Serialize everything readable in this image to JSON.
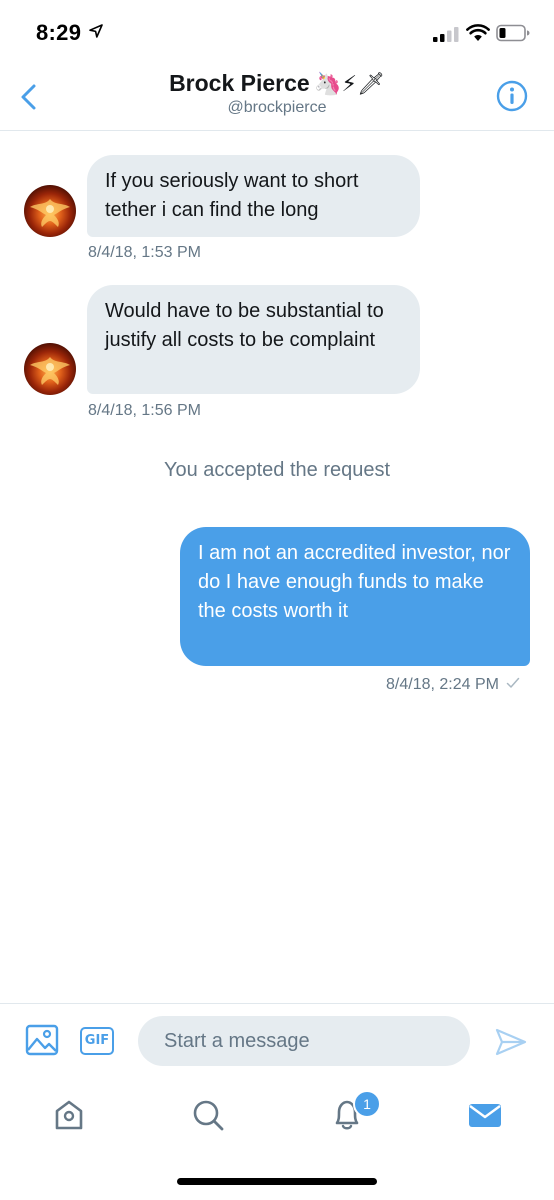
{
  "status_bar": {
    "time": "8:29",
    "icons": [
      "location-arrow-icon",
      "signal-bars-icon",
      "wifi-icon",
      "battery-icon"
    ]
  },
  "header": {
    "back_icon": "chevron-left-icon",
    "name": "Brock Pierce",
    "name_emoji": "🦄⚡🗡",
    "handle": "@brockpierce",
    "info_icon": "info-circle-icon"
  },
  "messages": [
    {
      "direction": "incoming",
      "text": "If you seriously want to short tether i can find the long",
      "timestamp": "8/4/18, 1:53 PM"
    },
    {
      "direction": "incoming",
      "text": "Would have to be substantial to justify all costs to be complaint",
      "timestamp": "8/4/18, 1:56 PM"
    },
    {
      "direction": "outgoing",
      "text": "I am not an accredited investor, nor do I have enough funds to make the costs worth it",
      "timestamp": "8/4/18, 2:24 PM",
      "status_icon": "checkmark-icon"
    }
  ],
  "system_message": "You accepted the request",
  "composer": {
    "image_icon": "image-icon",
    "gif_label": "GIF",
    "placeholder": "Start a message",
    "value": "",
    "send_icon": "send-icon"
  },
  "tabbar": {
    "tabs": [
      "home-icon",
      "search-icon",
      "notifications-icon",
      "messages-icon"
    ],
    "notification_count": "1",
    "active_tab": "messages"
  },
  "colors": {
    "accent": "#4a9fe8",
    "bubble_incoming": "#e6ecf0",
    "secondary_text": "#657786",
    "divider": "#e1e8ed"
  }
}
